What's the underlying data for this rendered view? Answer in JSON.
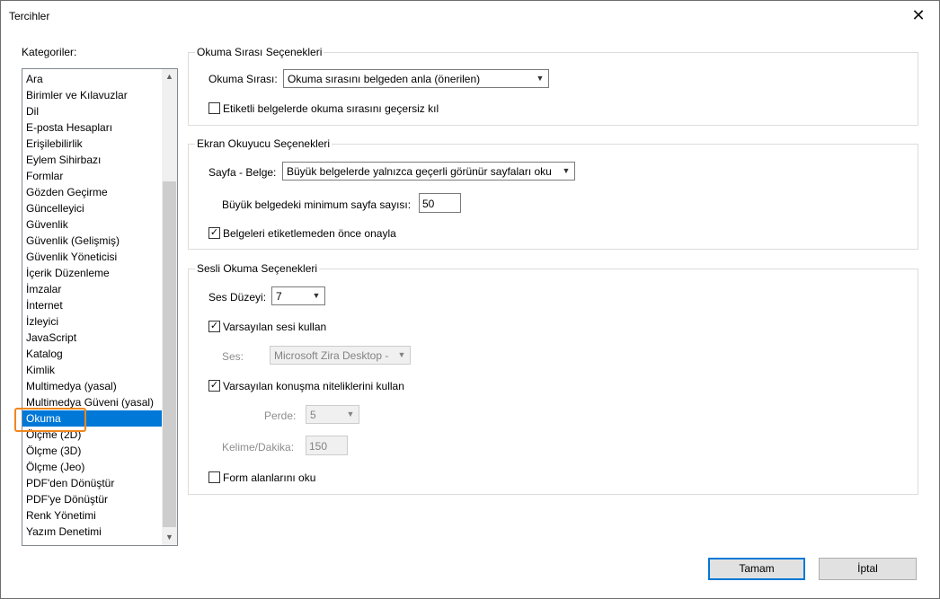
{
  "window": {
    "title": "Tercihler"
  },
  "categories": {
    "label": "Kategoriler:",
    "items": [
      "Ara",
      "Birimler ve Kılavuzlar",
      "Dil",
      "E-posta Hesapları",
      "Erişilebilirlik",
      "Eylem Sihirbazı",
      "Formlar",
      "Gözden Geçirme",
      "Güncelleyici",
      "Güvenlik",
      "Güvenlik (Gelişmiş)",
      "Güvenlik Yöneticisi",
      "İçerik Düzenleme",
      "İmzalar",
      "İnternet",
      "İzleyici",
      "JavaScript",
      "Katalog",
      "Kimlik",
      "Multimedya (yasal)",
      "Multimedya Güveni (yasal)",
      "Okuma",
      "Ölçme (2D)",
      "Ölçme (3D)",
      "Ölçme (Jeo)",
      "PDF'den Dönüştür",
      "PDF'ye Dönüştür",
      "Renk Yönetimi",
      "Yazım Denetimi"
    ],
    "selected": "Okuma"
  },
  "reading_order": {
    "title": "Okuma Sırası Seçenekleri",
    "order_label": "Okuma Sırası:",
    "order_value": "Okuma sırasını belgeden anla (önerilen)",
    "override_label": "Etiketli belgelerde okuma sırasını geçersiz kıl",
    "override_checked": false
  },
  "screen_reader": {
    "title": "Ekran Okuyucu Seçenekleri",
    "page_doc_label": "Sayfa - Belge:",
    "page_doc_value": "Büyük belgelerde yalnızca geçerli görünür sayfaları oku",
    "min_pages_label": "Büyük belgedeki minimum sayfa sayısı:",
    "min_pages_value": "50",
    "confirm_label": "Belgeleri etiketlemeden önce onayla",
    "confirm_checked": true
  },
  "read_aloud": {
    "title": "Sesli Okuma Seçenekleri",
    "volume_label": "Ses Düzeyi:",
    "volume_value": "7",
    "default_voice_label": "Varsayılan sesi kullan",
    "default_voice_checked": true,
    "voice_label": "Ses:",
    "voice_value": "Microsoft Zira Desktop -",
    "default_speech_label": "Varsayılan konuşma niteliklerini kullan",
    "default_speech_checked": true,
    "pitch_label": "Perde:",
    "pitch_value": "5",
    "wpm_label": "Kelime/Dakika:",
    "wpm_value": "150",
    "form_fields_label": "Form alanlarını oku",
    "form_fields_checked": false
  },
  "buttons": {
    "ok": "Tamam",
    "cancel": "İptal"
  },
  "colors": {
    "selection": "#0078d7",
    "highlight_outline": "#f0861e"
  }
}
